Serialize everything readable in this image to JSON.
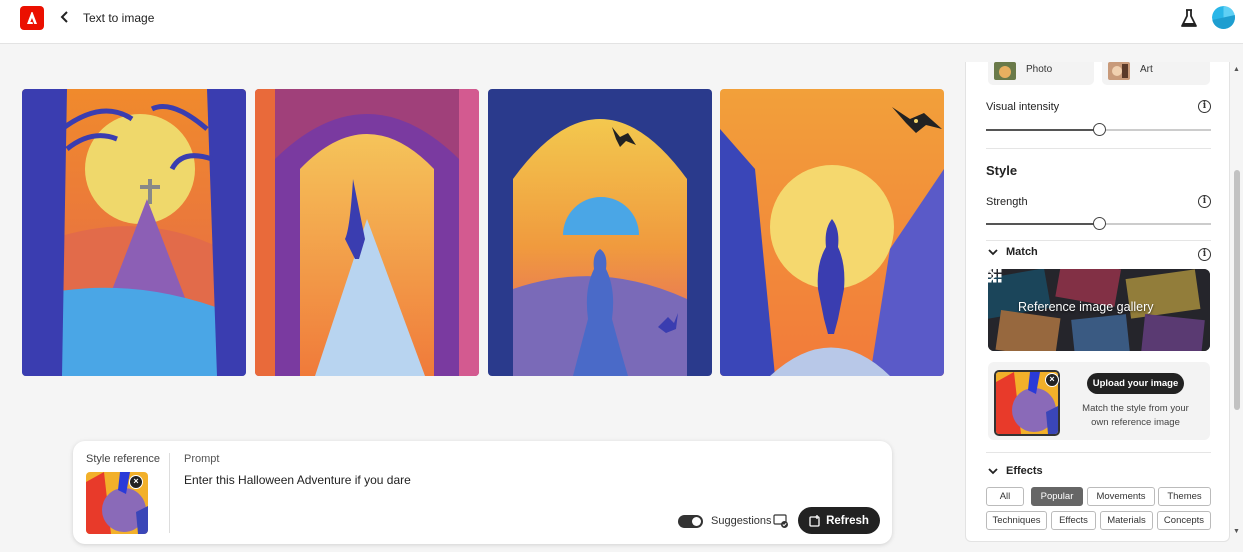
{
  "header": {
    "title": "Text to image",
    "logo_icon": "adobe-logo-icon",
    "back_icon": "chevron-left-icon",
    "labs_icon": "flask-icon",
    "brand_color": "#eb1000"
  },
  "gallery": {
    "images": [
      {
        "subject": "moon-cross-trees"
      },
      {
        "subject": "arch-cloaked-figure"
      },
      {
        "subject": "arch-bats-woman"
      },
      {
        "subject": "moon-bats-walker"
      }
    ]
  },
  "prompt_bar": {
    "style_reference_label": "Style reference",
    "prompt_label": "Prompt",
    "prompt_value": "Enter this Halloween Adventure if you dare",
    "suggestions_label": "Suggestions",
    "suggestions_on": true,
    "refresh_label": "Refresh"
  },
  "panel": {
    "content_types": [
      {
        "label": "Photo"
      },
      {
        "label": "Art"
      }
    ],
    "visual_intensity": {
      "label": "Visual intensity",
      "value": 0.5
    },
    "style": {
      "heading": "Style",
      "strength_label": "Strength",
      "strength_value": 0.5,
      "match_label": "Match",
      "gallery_label": "Reference image gallery",
      "upload_button": "Upload your image",
      "upload_desc": "Match the style from your own reference image"
    },
    "effects": {
      "heading": "Effects",
      "chips": [
        {
          "label": "All",
          "active": false
        },
        {
          "label": "Popular",
          "active": true
        },
        {
          "label": "Movements",
          "active": false
        },
        {
          "label": "Themes",
          "active": false
        },
        {
          "label": "Techniques",
          "active": false
        },
        {
          "label": "Effects",
          "active": false
        },
        {
          "label": "Materials",
          "active": false
        },
        {
          "label": "Concepts",
          "active": false
        }
      ]
    }
  }
}
